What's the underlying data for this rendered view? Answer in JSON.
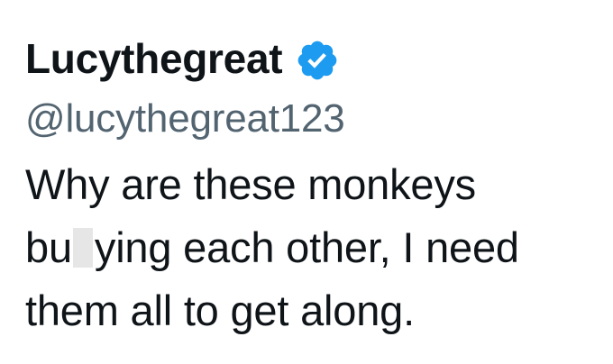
{
  "tweet": {
    "display_name": "Lucythegreat",
    "verified": true,
    "badge_color": "#1d9bf0",
    "handle": "@lucythegreat123",
    "text_line1": "Why are these monkeys",
    "text_line2_before_censor": "bu",
    "text_line2_after_censor": "ying each other, I need",
    "text_line3": "them all to get along."
  }
}
